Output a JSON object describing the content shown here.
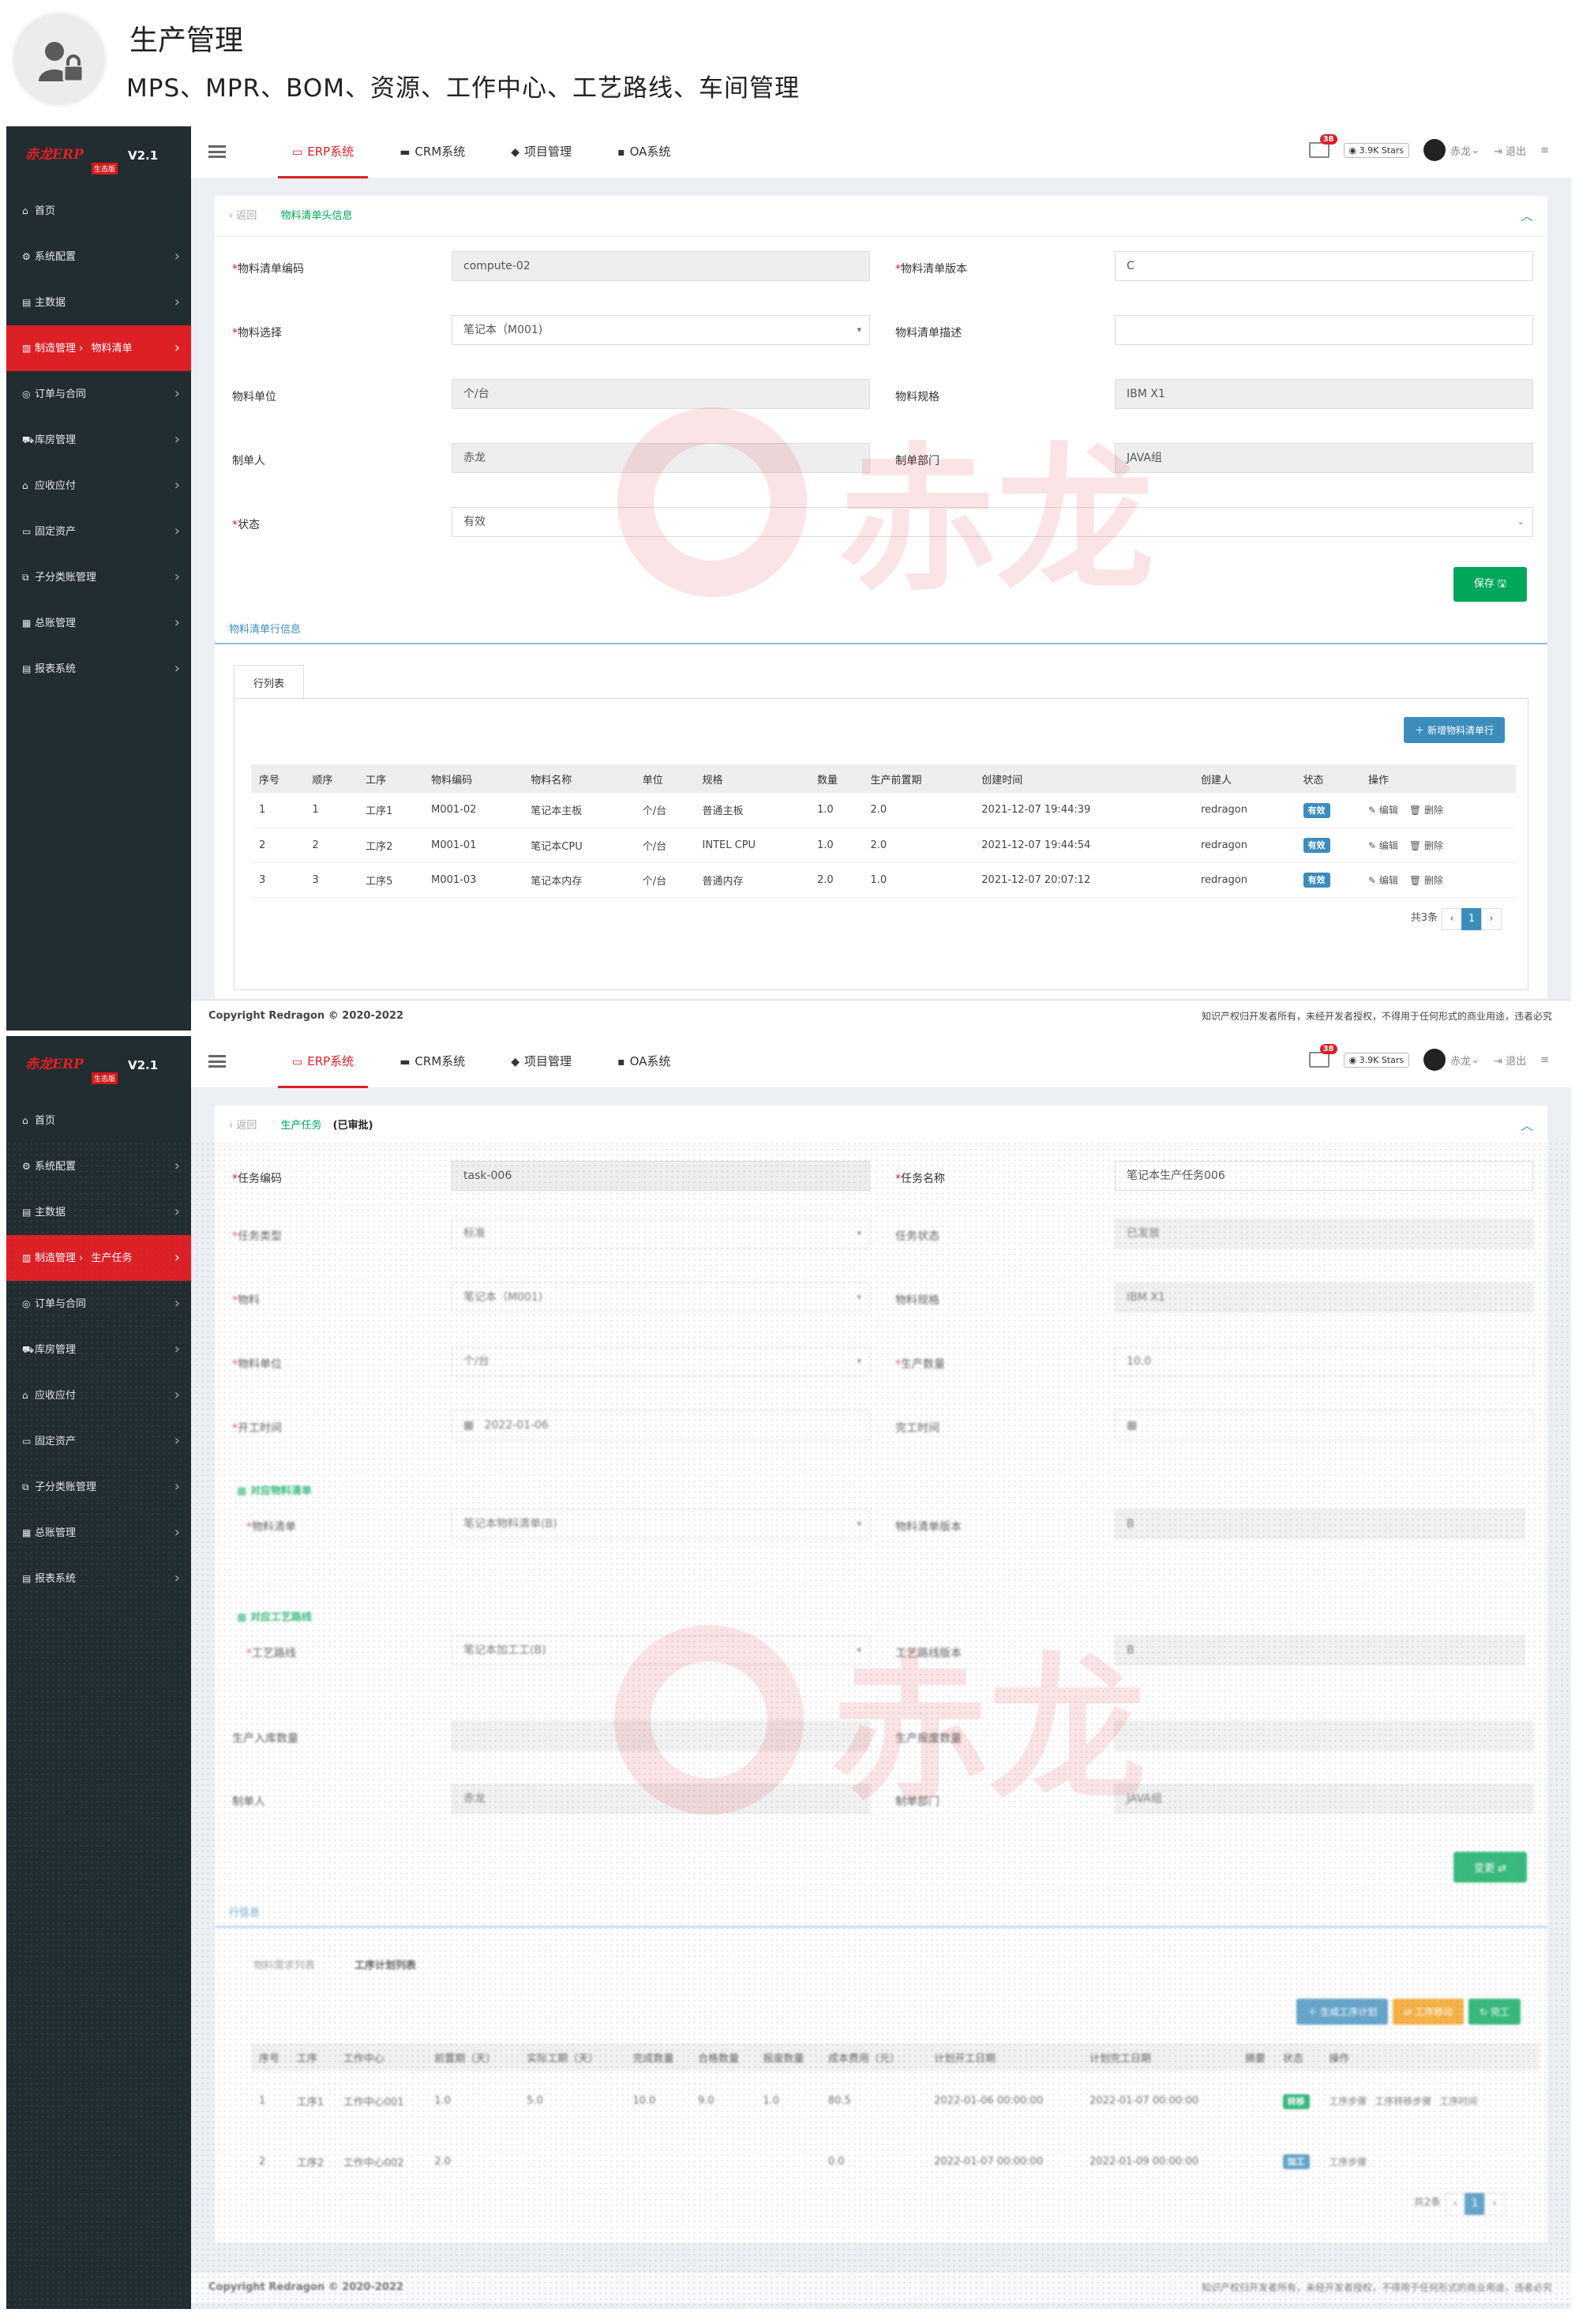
{
  "header": {
    "title": "生产管理",
    "subtitle": "MPS、MPR、BOM、资源、工作中心、工艺路线、车间管理"
  },
  "brand": {
    "logo": "赤龙",
    "logo_suffix": "ERP",
    "version": "V2.1",
    "edition": "生态版",
    "watermark": "赤龙",
    "accent": "#dd1f26",
    "sidebar_bg": "#222d32"
  },
  "menu": [
    {
      "label": "首页",
      "icon": "home-icon"
    },
    {
      "label": "系统配置",
      "icon": "gear-icon"
    },
    {
      "label": "主数据",
      "icon": "database-icon"
    },
    {
      "label": "制造管理",
      "icon": "chart-icon"
    },
    {
      "label": "订单与合同",
      "icon": "eye-icon"
    },
    {
      "label": "库房管理",
      "icon": "truck-icon"
    },
    {
      "label": "应收应付",
      "icon": "bank-icon"
    },
    {
      "label": "固定资产",
      "icon": "monitor-icon"
    },
    {
      "label": "子分类账管理",
      "icon": "sitemap-icon"
    },
    {
      "label": "总账管理",
      "icon": "book-icon"
    },
    {
      "label": "报表系统",
      "icon": "report-icon"
    }
  ],
  "nav": {
    "tabs": [
      "ERP系统",
      "CRM系统",
      "项目管理",
      "OA系统"
    ],
    "mail_count": "38",
    "stars": "3.9K Stars",
    "user": "赤龙",
    "logout": "退出"
  },
  "screen1": {
    "menu_sub": "物料清单",
    "breadcrumb": {
      "back": "返回",
      "current": "物料清单头信息"
    },
    "fields": {
      "code_label": "物料清单编码",
      "code": "compute-02",
      "version_label": "物料清单版本",
      "version": "C",
      "material_label": "物料选择",
      "material": "笔记本（M001)",
      "desc_label": "物料清单描述",
      "desc": "",
      "unit_label": "物料单位",
      "unit": "个/台",
      "spec_label": "物料规格",
      "spec": "IBM X1",
      "creator_label": "制单人",
      "creator": "赤龙",
      "dept_label": "制单部门",
      "dept": "JAVA组",
      "status_label": "状态",
      "status": "有效"
    },
    "save": "保存",
    "section": "物料清单行信息",
    "tab": "行列表",
    "add_btn": "新增物料清单行",
    "columns": [
      "序号",
      "顺序",
      "工序",
      "物料编码",
      "物料名称",
      "单位",
      "规格",
      "数量",
      "生产前置期",
      "创建时间",
      "创建人",
      "状态",
      "操作"
    ],
    "rows": [
      [
        "1",
        "1",
        "工序1",
        "M001-02",
        "笔记本主板",
        "个/台",
        "普通主板",
        "1.0",
        "2.0",
        "2021-12-07 19:44:39",
        "redragon",
        "有效"
      ],
      [
        "2",
        "2",
        "工序2",
        "M001-01",
        "笔记本CPU",
        "个/台",
        "INTEL CPU",
        "1.0",
        "2.0",
        "2021-12-07 19:44:54",
        "redragon",
        "有效"
      ],
      [
        "3",
        "3",
        "工序5",
        "M001-03",
        "笔记本内存",
        "个/台",
        "普通内存",
        "2.0",
        "1.0",
        "2021-12-07 20:07:12",
        "redragon",
        "有效"
      ]
    ],
    "edit": "编辑",
    "delete": "删除",
    "total": "共3条",
    "page": "1",
    "copyright": "Copyright Redragon © 2020-2022",
    "notice": "知识产权归开发者所有，未经开发者授权，不得用于任何形式的商业用途，违者必究"
  },
  "screen2": {
    "menu_sub": "生产任务",
    "breadcrumb": {
      "back": "返回",
      "current": "生产任务",
      "state": "(已审批)"
    },
    "fields": {
      "code_label": "任务编码",
      "code": "task-006",
      "name_label": "任务名称",
      "name": "笔记本生产任务006",
      "type_label": "任务类型",
      "type": "标准",
      "state_label": "任务状态",
      "state": "已发放",
      "mat_label": "物料",
      "mat": "笔记本（M001)",
      "spec_label": "物料规格",
      "spec": "IBM X1",
      "unit_label": "物料单位",
      "unit": "个/台",
      "qty_label": "生产数量",
      "qty": "10.0",
      "start_label": "开工时间",
      "start": "2022-01-06",
      "end_label": "完工时间",
      "end": "",
      "bom_title": "对应物料清单",
      "bom_label": "物料清单",
      "bom": "笔记本物料清单(B)",
      "bomver_label": "物料清单版本",
      "bomver": "B",
      "route_title": "对应工艺路线",
      "route_label": "工艺路线",
      "route": "笔记本加工工(B)",
      "routever_label": "工艺路线版本",
      "routever": "B",
      "in_label": "生产入库数量",
      "in": "",
      "scrap_label": "生产报废数量",
      "scrap": "",
      "creator_label": "制单人",
      "creator": "赤龙",
      "dept_label": "制单部门",
      "dept": "JAVA组"
    },
    "change": "变更",
    "section": "行信息",
    "tabs": [
      "物料需求列表",
      "工序计划列表"
    ],
    "btns": [
      "生成工序计划",
      "工序移动",
      "完工"
    ],
    "columns": [
      "序号",
      "工序",
      "工作中心",
      "前置期（天）",
      "实际工期（天）",
      "完成数量",
      "合格数量",
      "报废数量",
      "成本费用（元）",
      "计划开工日期",
      "计划完工日期",
      "摘要",
      "状态",
      "操作"
    ],
    "rows": [
      [
        "1",
        "工序1",
        "工作中心001",
        "1.0",
        "5.0",
        "10.0",
        "9.0",
        "1.0",
        "80.5",
        "2022-01-06 00:00:00",
        "2022-01-07 00:00:00",
        "",
        "转移"
      ],
      [
        "2",
        "工序2",
        "工作中心002",
        "2.0",
        "",
        "",
        "",
        "",
        "0.0",
        "2022-01-07 00:00:00",
        "2022-01-09 00:00:00",
        "",
        "加工"
      ]
    ],
    "ops1": [
      "工序步骤",
      "工序转移步骤",
      "工序时间"
    ],
    "ops2": [
      "工序步骤"
    ],
    "total": "共2条",
    "page": "1",
    "copyright": "Copyright Redragon © 2020-2022",
    "notice": "知识产权归开发者所有，未经开发者授权，不得用于任何形式的商业用途，违者必究"
  }
}
